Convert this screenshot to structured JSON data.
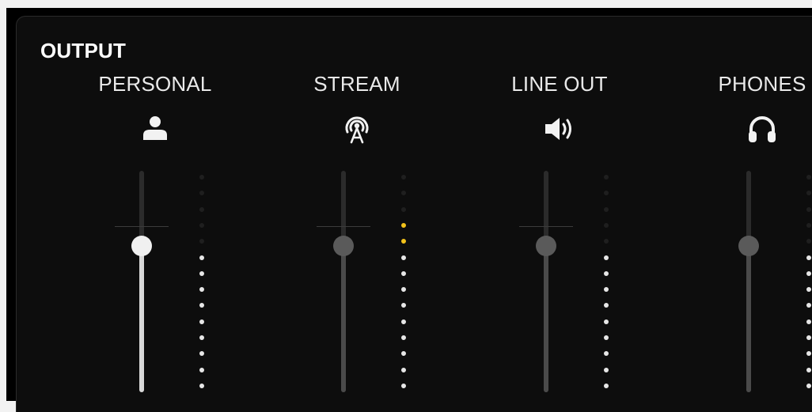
{
  "section_title": "OUTPUT",
  "colors": {
    "led_off": "#1f1f1f",
    "led_on": "#e6e6e6",
    "led_warn": "#f2c21b",
    "thumb_active": "#f0f0f0",
    "thumb_inactive": "#5a5a5a",
    "fill_active": "#d8d8d8",
    "fill_inactive": "#4a4a4a"
  },
  "channels": [
    {
      "id": "personal",
      "label": "PERSONAL",
      "icon": "person-icon",
      "level": 0.66,
      "active": true,
      "unity_mark": true,
      "meter_leds": [
        0,
        0,
        0,
        0,
        0,
        1,
        1,
        1,
        1,
        1,
        1,
        1,
        1,
        1
      ]
    },
    {
      "id": "stream",
      "label": "STREAM",
      "icon": "broadcast-icon",
      "level": 0.66,
      "active": false,
      "unity_mark": true,
      "meter_leds": [
        0,
        0,
        0,
        2,
        2,
        1,
        1,
        1,
        1,
        1,
        1,
        1,
        1,
        1
      ]
    },
    {
      "id": "line_out",
      "label": "LINE OUT",
      "icon": "speaker-icon",
      "level": 0.66,
      "active": false,
      "unity_mark": true,
      "meter_leds": [
        0,
        0,
        0,
        0,
        0,
        1,
        1,
        1,
        1,
        1,
        1,
        1,
        1,
        1
      ]
    },
    {
      "id": "phones",
      "label": "PHONES",
      "icon": "headphones-icon",
      "level": 0.66,
      "active": false,
      "unity_mark": false,
      "meter_leds": [
        0,
        0,
        0,
        0,
        0,
        1,
        1,
        1,
        1,
        1,
        1,
        1,
        1,
        1
      ]
    }
  ]
}
